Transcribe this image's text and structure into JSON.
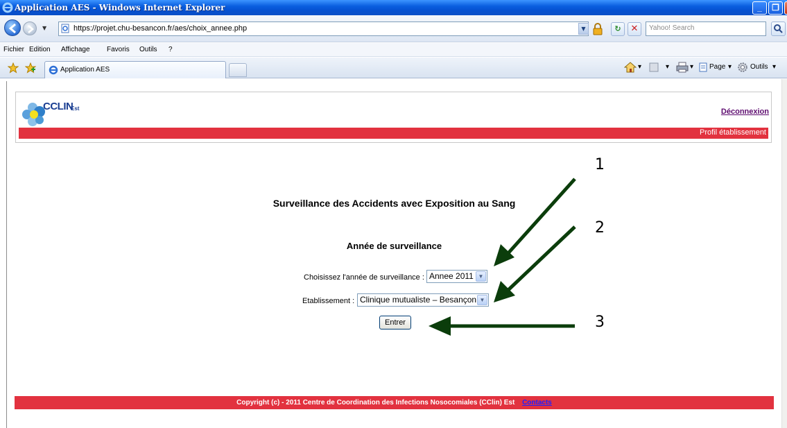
{
  "window": {
    "title": "Application AES - Windows Internet Explorer"
  },
  "address_bar": {
    "url": "https://projet.chu-besancon.fr/aes/choix_annee.php",
    "search_placeholder": "Yahoo! Search"
  },
  "menu": {
    "items": [
      "Fichier",
      "Edition",
      "Affichage",
      "Favoris",
      "Outils",
      "?"
    ]
  },
  "tabs": {
    "active_label": "Application AES"
  },
  "command_bar": {
    "page_label": "Page",
    "tools_label": "Outils"
  },
  "header": {
    "logo_text": "CCLIN",
    "logo_suffix": "Est",
    "logout_label": "Déconnexion",
    "profile_label": "Profil établissement"
  },
  "main": {
    "title": "Surveillance des Accidents avec Exposition au Sang",
    "section_title": "Année de surveillance",
    "year_label": "Choisissez l'année de surveillance :",
    "year_value": "Annee 2011",
    "establishment_label": "Etablissement :",
    "establishment_value": "Clinique mutualiste – Besançon",
    "submit_label": "Entrer"
  },
  "footer": {
    "copyright": "Copyright (c) - 2011 Centre de Coordination des Infections Nosocomiales (CClin) Est",
    "contacts_label": "Contacts"
  },
  "annotations": {
    "labels": [
      "1",
      "2",
      "3"
    ],
    "arrow_color": "#0b3d0b"
  },
  "colors": {
    "header_bar": "#e2323f",
    "logout_link": "#5c0a6e",
    "footer_link": "#2020ff"
  }
}
